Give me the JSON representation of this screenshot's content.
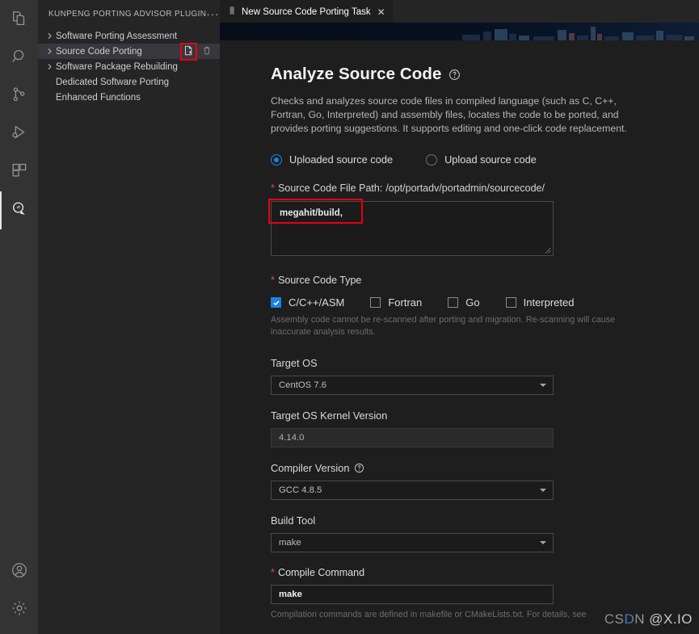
{
  "activity_bar": {
    "items": [
      {
        "name": "explorer-icon",
        "label": "Explorer",
        "active": false
      },
      {
        "name": "search-icon",
        "label": "Search",
        "active": false
      },
      {
        "name": "source-control-icon",
        "label": "Source Control",
        "active": false
      },
      {
        "name": "run-debug-icon",
        "label": "Run and Debug",
        "active": false
      },
      {
        "name": "extensions-icon",
        "label": "Extensions",
        "active": false
      },
      {
        "name": "kunpeng-porting-advisor-icon",
        "label": "Kunpeng Porting Advisor",
        "active": true
      }
    ],
    "bottom_items": [
      {
        "name": "account-icon",
        "label": "Accounts"
      },
      {
        "name": "settings-gear-icon",
        "label": "Manage"
      }
    ]
  },
  "sidebar": {
    "title": "KUNPENG PORTING ADVISOR PLUGIN",
    "more_actions": "···",
    "items": [
      {
        "label": "Software Porting Assessment",
        "chevron": true,
        "selected": false
      },
      {
        "label": "Source Code Porting",
        "chevron": true,
        "selected": true
      },
      {
        "label": "Software Package Rebuilding",
        "chevron": true,
        "selected": false
      },
      {
        "label": "Dedicated Software Porting",
        "chevron": false,
        "selected": false
      },
      {
        "label": "Enhanced Functions",
        "chevron": false,
        "selected": false
      }
    ],
    "row_actions": [
      {
        "name": "new-task-icon",
        "label": "New Task",
        "highlighted": true
      },
      {
        "name": "delete-task-icon",
        "label": "Delete Task",
        "highlighted": false
      }
    ]
  },
  "editor": {
    "tab": {
      "label": "New Source Code Porting Task",
      "close": "✕"
    }
  },
  "form": {
    "title": "Analyze Source Code",
    "title_help": "help-circle-icon",
    "description": "Checks and analyzes source code files in compiled language (such as C, C++, Fortran, Go, Interpreted) and assembly files, locates the code to be ported, and provides porting suggestions. It supports editing and one-click code replacement.",
    "source_mode": {
      "options": [
        {
          "label": "Uploaded source code",
          "selected": true
        },
        {
          "label": "Upload source code",
          "selected": false
        }
      ]
    },
    "file_path": {
      "required_marker": "*",
      "label": "Source Code File Path:",
      "base_path": "/opt/portadv/portadmin/sourcecode/",
      "value": "megahit/build,",
      "highlighted": true
    },
    "source_code_type": {
      "required_marker": "*",
      "label": "Source Code Type",
      "options": [
        {
          "label": "C/C++/ASM",
          "checked": true
        },
        {
          "label": "Fortran",
          "checked": false
        },
        {
          "label": "Go",
          "checked": false
        },
        {
          "label": "Interpreted",
          "checked": false
        }
      ],
      "hint": "Assembly code cannot be re-scanned after porting and migration. Re-scanning will cause inaccurate analysis results."
    },
    "target_os": {
      "label": "Target OS",
      "value": "CentOS 7.6",
      "control": "select"
    },
    "target_os_kernel_version": {
      "label": "Target OS Kernel Version",
      "value": "4.14.0",
      "control": "input",
      "readonly": true
    },
    "compiler_version": {
      "label": "Compiler Version",
      "help": "help-circle-icon",
      "value": "GCC 4.8.5",
      "control": "select"
    },
    "build_tool": {
      "label": "Build Tool",
      "value": "make",
      "control": "select"
    },
    "compile_command": {
      "required_marker": "*",
      "label": "Compile Command",
      "value": "make",
      "control": "input",
      "hint": "Compilation commands are defined in makefile or CMakeLists.txt. For details, see"
    }
  },
  "watermark": {
    "brand": "CSDN",
    "user": "@X.IO"
  }
}
